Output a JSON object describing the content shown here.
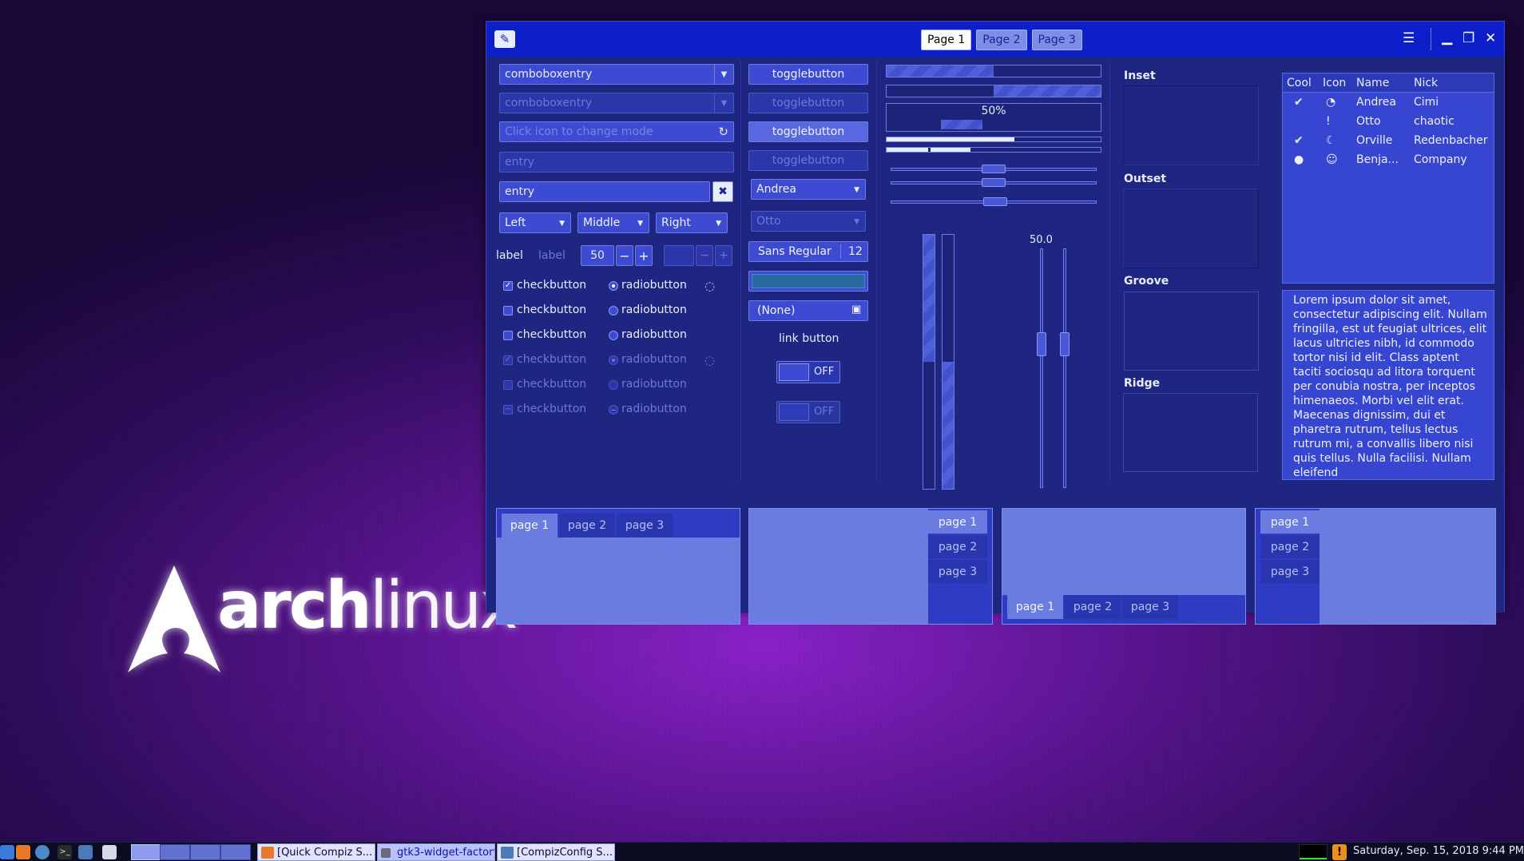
{
  "desktop": {
    "logo_text_bold": "arch",
    "logo_text_thin": "linux"
  },
  "titlebar": {
    "stack_tabs": [
      "Page 1",
      "Page 2",
      "Page 3"
    ],
    "active_stack_tab": 0
  },
  "col1": {
    "combo1": "comboboxentry",
    "combo2": "comboboxentry",
    "mode_entry_placeholder": "Click icon to change mode",
    "entry_placeholder": "entry",
    "entry_value": "entry",
    "combos": [
      "Left",
      "Middle",
      "Right"
    ],
    "label1": "label",
    "label2": "label",
    "spin_value": "50",
    "minus": "−",
    "plus": "+",
    "checkbuttons": [
      {
        "label": "checkbutton",
        "state": "checked",
        "disabled": false
      },
      {
        "label": "checkbutton",
        "state": "unchecked",
        "disabled": false
      },
      {
        "label": "checkbutton",
        "state": "unchecked",
        "disabled": false
      },
      {
        "label": "checkbutton",
        "state": "checked",
        "disabled": true
      },
      {
        "label": "checkbutton",
        "state": "unchecked",
        "disabled": true
      },
      {
        "label": "checkbutton",
        "state": "mixed",
        "disabled": true
      }
    ],
    "radiobuttons": [
      {
        "label": "radiobutton",
        "state": "on",
        "disabled": false
      },
      {
        "label": "radiobutton",
        "state": "off",
        "disabled": false
      },
      {
        "label": "radiobutton",
        "state": "off",
        "disabled": false
      },
      {
        "label": "radiobutton",
        "state": "on",
        "disabled": true
      },
      {
        "label": "radiobutton",
        "state": "off",
        "disabled": true
      },
      {
        "label": "radiobutton",
        "state": "mixed",
        "disabled": true
      }
    ]
  },
  "col2": {
    "togglebuttons": [
      "togglebutton",
      "togglebutton",
      "togglebutton",
      "togglebutton"
    ],
    "combo_name": "Andrea",
    "combo_name_disabled": "Otto",
    "font_name": "Sans Regular",
    "font_size": "12",
    "file_chooser": "(None)",
    "link_button": "link button",
    "switch1": "OFF",
    "switch2": "OFF"
  },
  "col3": {
    "progress_top": 0.5,
    "progress_second": 0.5,
    "progress_label": "50%",
    "scale_value_label": "50.0",
    "vertical_progress": [
      0.5,
      0.5
    ]
  },
  "frames": [
    "Inset",
    "Outset",
    "Groove",
    "Ridge"
  ],
  "tree": {
    "columns": [
      "Cool",
      "Icon",
      "Name",
      "Nick"
    ],
    "rows": [
      {
        "cool": "✔",
        "icon": "◔",
        "name": "Andrea",
        "nick": "Cimi"
      },
      {
        "cool": "",
        "icon": "!",
        "name": "Otto",
        "nick": "chaotic"
      },
      {
        "cool": "✔",
        "icon": "☾",
        "name": "Orville",
        "nick": "Redenbacher"
      },
      {
        "cool": "●",
        "icon": "☺",
        "name": "Benja...",
        "nick": "Company"
      }
    ]
  },
  "textview": "Lorem ipsum dolor sit amet, consectetur adipiscing elit. Nullam fringilla, est ut feugiat ultrices, elit lacus ultricies nibh, id commodo tortor nisi id elit. Class aptent taciti sociosqu ad litora torquent per conubia nostra, per inceptos himenaeos. Morbi vel elit erat. Maecenas dignissim, dui et pharetra rutrum, tellus lectus rutrum mi, a convallis libero nisi quis tellus. Nulla facilisi. Nullam eleifend",
  "notebooks": {
    "tabs": [
      "page 1",
      "page 2",
      "page 3"
    ]
  },
  "taskbar": {
    "tasks": [
      "[Quick Compiz S...",
      "gtk3-widget-factory",
      "[CompizConfig S..."
    ],
    "active_task": 1,
    "clock": "Saturday, Sep. 15, 2018   9:44 PM",
    "warning_icon": "!"
  },
  "colors": {
    "titlebar": "#0d1fc8",
    "window_bg": "#1f2682",
    "widget_bg": "#3d4bd2",
    "notebook_page": "#6a7ce0"
  }
}
